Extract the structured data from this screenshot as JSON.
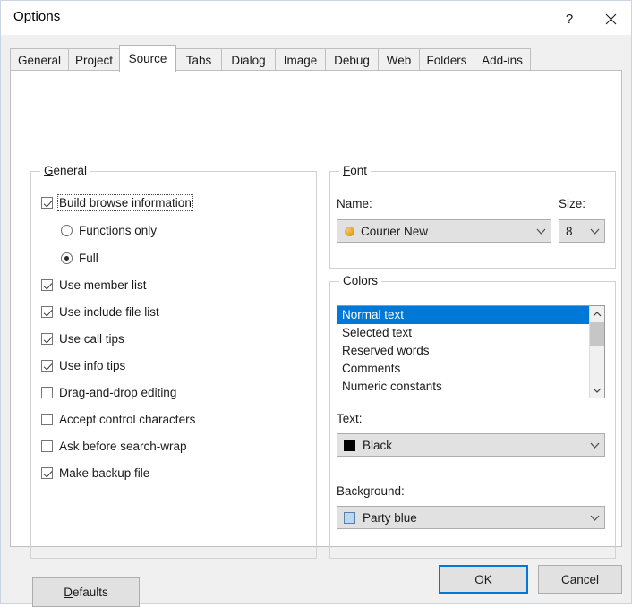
{
  "window": {
    "title": "Options",
    "help_icon": "question-mark-icon",
    "close_icon": "close-icon"
  },
  "tabs": [
    {
      "label": "General",
      "selected": false
    },
    {
      "label": "Project",
      "selected": false
    },
    {
      "label": "Source",
      "selected": true
    },
    {
      "label": "Tabs",
      "selected": false
    },
    {
      "label": "Dialog",
      "selected": false
    },
    {
      "label": "Image",
      "selected": false
    },
    {
      "label": "Debug",
      "selected": false
    },
    {
      "label": "Web",
      "selected": false
    },
    {
      "label": "Folders",
      "selected": false
    },
    {
      "label": "Add-ins",
      "selected": false
    }
  ],
  "general_group": {
    "title": "General",
    "accel_letter": "G",
    "title_rest": "eneral",
    "options": [
      {
        "label": "Build browse information",
        "type": "checkbox",
        "checked": true,
        "focused": true
      },
      {
        "label": "Functions only",
        "type": "radio",
        "checked": false,
        "indent": true
      },
      {
        "label": "Full",
        "type": "radio",
        "checked": true,
        "indent": true
      },
      {
        "label": "Use member list",
        "type": "checkbox",
        "checked": true
      },
      {
        "label": "Use include file list",
        "type": "checkbox",
        "checked": true
      },
      {
        "label": "Use call tips",
        "type": "checkbox",
        "checked": true
      },
      {
        "label": "Use info tips",
        "type": "checkbox",
        "checked": true
      },
      {
        "label": "Drag-and-drop editing",
        "type": "checkbox",
        "checked": false
      },
      {
        "label": "Accept control characters",
        "type": "checkbox",
        "checked": false
      },
      {
        "label": "Ask before search-wrap",
        "type": "checkbox",
        "checked": false
      },
      {
        "label": "Make backup file",
        "type": "checkbox",
        "checked": true
      }
    ]
  },
  "font_group": {
    "title": "Font",
    "accel_letter": "F",
    "title_rest": "ont",
    "name_label": "Name:",
    "name_value": "Courier New",
    "name_icon": "truetype-font-dot-icon",
    "size_label": "Size:",
    "size_value": "8"
  },
  "colors_group": {
    "title": "Colors",
    "accel_letter": "C",
    "title_rest": "olors",
    "list_items": [
      "Normal text",
      "Selected text",
      "Reserved words",
      "Comments",
      "Numeric constants"
    ],
    "selected_index": 0,
    "scrollbar": {
      "up_icon": "chevron-up-icon",
      "down_icon": "chevron-down-icon"
    },
    "text_label": "Text:",
    "text_value": "Black",
    "text_swatch_color": "#000000",
    "background_label": "Background:",
    "background_value": "Party blue",
    "background_swatch_color": "#bad8f2"
  },
  "buttons": {
    "defaults": "Defaults",
    "defaults_accel_letter": "D",
    "defaults_rest": "efaults",
    "ok": "OK",
    "cancel": "Cancel"
  },
  "colors": {
    "accent": "#0078d7",
    "dialog_bg": "#f0f0f0",
    "panel_bg": "#ffffff",
    "control_bg": "#e1e1e1"
  }
}
